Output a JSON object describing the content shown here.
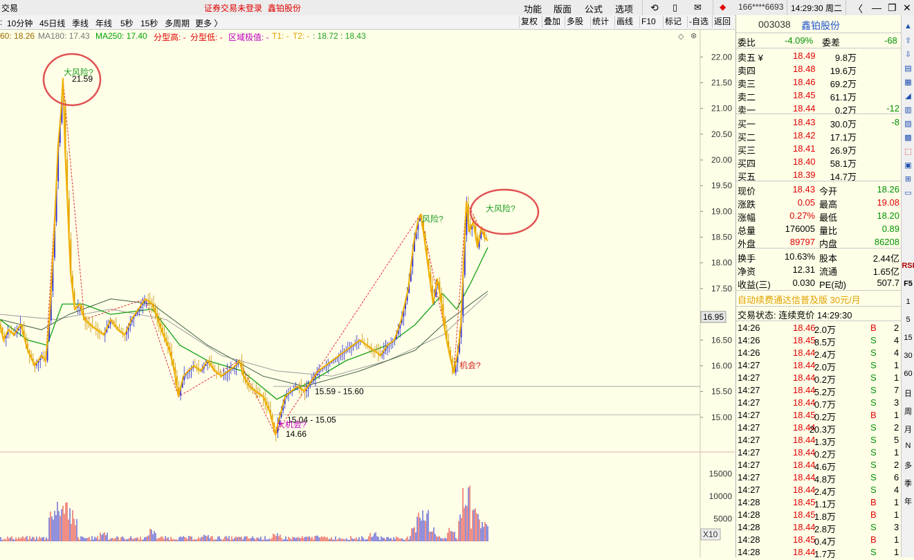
{
  "topbar": {
    "left_label": "交易",
    "login_status": "证券交易未登录",
    "stock_name": "鑫铂股份",
    "menu": [
      "功能",
      "版面",
      "公式",
      "选项"
    ],
    "account": "166****6693",
    "clock": "14:29:30 周二"
  },
  "periods": [
    "10分钟",
    "45日线",
    "季线",
    "年线",
    "5秒",
    "15秒",
    "多周期",
    "更多 〉"
  ],
  "toolbar": [
    "复权",
    "叠加",
    "多股",
    "统计",
    "画线",
    "F10",
    "标记",
    "-自选",
    "返回"
  ],
  "indicators": {
    "ma60": "60: 18.26",
    "ma180": "MA180: 17.43",
    "ma250": "MA250: 17.40",
    "top": "分型高: -",
    "bottom": "分型低: -",
    "zone": "区域极值: -",
    "t1": "T1: -",
    "t2": "T2: -",
    "tvals": ": 18.72 : 18.43"
  },
  "colors": {
    "up": "#e00000",
    "down": "#009000",
    "ma_yellow": "#f0b000",
    "candle_blue": "#2020d0",
    "annot_purple": "#c000c0",
    "circle": "#e05050"
  },
  "chart_data": {
    "type": "candlestick",
    "y_axis": {
      "ylim": [
        14.5,
        22.3
      ],
      "ticks": [
        "22.00",
        "21.50",
        "21.00",
        "20.50",
        "20.00",
        "19.50",
        "19.00",
        "18.50",
        "18.00",
        "17.50",
        "16.50",
        "16.00",
        "15.50",
        "15.00"
      ]
    },
    "current_price_tag": "16.95",
    "volume_axis": {
      "ticks": [
        "15000",
        "10000",
        "5000"
      ],
      "multiplier": "X10",
      "ylim": [
        0,
        18000
      ]
    },
    "price_path": [
      [
        0,
        16.8
      ],
      [
        5,
        16.5
      ],
      [
        12,
        16.7
      ],
      [
        20,
        16.6
      ],
      [
        30,
        16.8
      ],
      [
        40,
        16.3
      ],
      [
        50,
        16.0
      ],
      [
        60,
        16.2
      ],
      [
        66,
        16.1
      ],
      [
        72,
        17.0
      ],
      [
        78,
        18.5
      ],
      [
        84,
        20.3
      ],
      [
        88,
        20.9
      ],
      [
        91,
        21.59
      ],
      [
        94,
        20.2
      ],
      [
        98,
        19.0
      ],
      [
        102,
        17.8
      ],
      [
        108,
        17.1
      ],
      [
        115,
        17.2
      ],
      [
        122,
        16.9
      ],
      [
        130,
        16.8
      ],
      [
        140,
        16.7
      ],
      [
        150,
        16.6
      ],
      [
        160,
        16.9
      ],
      [
        170,
        16.7
      ],
      [
        180,
        16.6
      ],
      [
        190,
        16.9
      ],
      [
        200,
        17.1
      ],
      [
        210,
        17.3
      ],
      [
        220,
        17.2
      ],
      [
        228,
        16.9
      ],
      [
        236,
        16.6
      ],
      [
        245,
        16.3
      ],
      [
        252,
        15.9
      ],
      [
        258,
        15.4
      ],
      [
        265,
        15.8
      ],
      [
        272,
        15.9
      ],
      [
        280,
        16.0
      ],
      [
        290,
        15.9
      ],
      [
        300,
        16.1
      ],
      [
        310,
        15.9
      ],
      [
        320,
        15.8
      ],
      [
        330,
        15.9
      ],
      [
        340,
        16.0
      ],
      [
        346,
        16.1
      ],
      [
        352,
        15.8
      ],
      [
        360,
        15.6
      ],
      [
        370,
        15.5
      ],
      [
        380,
        15.4
      ],
      [
        390,
        15.1
      ],
      [
        398,
        14.66
      ],
      [
        404,
        15.0
      ],
      [
        412,
        15.4
      ],
      [
        420,
        15.5
      ],
      [
        430,
        15.6
      ],
      [
        440,
        15.5
      ],
      [
        450,
        15.7
      ],
      [
        460,
        15.9
      ],
      [
        470,
        16.0
      ],
      [
        480,
        16.1
      ],
      [
        490,
        16.2
      ],
      [
        500,
        16.3
      ],
      [
        510,
        16.4
      ],
      [
        520,
        16.5
      ],
      [
        530,
        16.4
      ],
      [
        540,
        16.3
      ],
      [
        550,
        16.2
      ],
      [
        560,
        16.4
      ],
      [
        570,
        16.5
      ],
      [
        580,
        16.9
      ],
      [
        590,
        17.5
      ],
      [
        598,
        18.4
      ],
      [
        604,
        18.8
      ],
      [
        608,
        18.95
      ],
      [
        614,
        18.4
      ],
      [
        620,
        17.8
      ],
      [
        626,
        17.2
      ],
      [
        632,
        17.7
      ],
      [
        638,
        17.2
      ],
      [
        644,
        16.6
      ],
      [
        650,
        16.2
      ],
      [
        656,
        15.85
      ],
      [
        662,
        16.3
      ],
      [
        666,
        16.8
      ],
      [
        670,
        18.0
      ],
      [
        674,
        19.2
      ],
      [
        678,
        18.6
      ],
      [
        684,
        18.8
      ],
      [
        690,
        18.3
      ],
      [
        696,
        18.7
      ],
      [
        700,
        18.5
      ],
      [
        705,
        18.43
      ]
    ],
    "ma_green_path": [
      [
        0,
        16.9
      ],
      [
        40,
        16.5
      ],
      [
        68,
        16.4
      ],
      [
        90,
        17.2
      ],
      [
        120,
        17.2
      ],
      [
        160,
        17.0
      ],
      [
        220,
        17.1
      ],
      [
        260,
        16.4
      ],
      [
        300,
        16.1
      ],
      [
        350,
        15.9
      ],
      [
        400,
        15.35
      ],
      [
        450,
        15.7
      ],
      [
        500,
        16.1
      ],
      [
        560,
        16.4
      ],
      [
        600,
        16.8
      ],
      [
        640,
        17.4
      ],
      [
        660,
        17.1
      ],
      [
        680,
        17.6
      ],
      [
        705,
        18.3
      ]
    ],
    "ma_dark_path": [
      [
        0,
        16.9
      ],
      [
        60,
        16.7
      ],
      [
        100,
        17.0
      ],
      [
        160,
        17.3
      ],
      [
        220,
        17.2
      ],
      [
        300,
        16.4
      ],
      [
        380,
        15.8
      ],
      [
        440,
        15.6
      ],
      [
        520,
        15.9
      ],
      [
        600,
        16.3
      ],
      [
        640,
        16.8
      ],
      [
        670,
        17.1
      ],
      [
        705,
        17.45
      ]
    ],
    "ma_gray_path": [
      [
        0,
        17.0
      ],
      [
        80,
        16.9
      ],
      [
        160,
        17.1
      ],
      [
        240,
        16.9
      ],
      [
        320,
        16.2
      ],
      [
        400,
        15.9
      ],
      [
        480,
        15.8
      ],
      [
        560,
        16.1
      ],
      [
        640,
        16.6
      ],
      [
        705,
        17.4
      ]
    ],
    "zigzag": [
      [
        66,
        16.1
      ],
      [
        91,
        21.59
      ],
      [
        122,
        16.9
      ],
      [
        210,
        17.3
      ],
      [
        258,
        15.4
      ],
      [
        346,
        16.1
      ],
      [
        398,
        14.66
      ],
      [
        608,
        18.95
      ],
      [
        656,
        15.85
      ],
      [
        674,
        19.2
      ],
      [
        700,
        18.5
      ]
    ],
    "hlines": [
      15.6,
      15.05
    ],
    "annotations": [
      {
        "text": "大风险?",
        "x": 92,
        "y": 21.65,
        "color": "#20a020"
      },
      {
        "text": "21.59",
        "x": 104,
        "y": 21.52,
        "color": "#000000"
      },
      {
        "text": "风险?",
        "x": 610,
        "y": 18.8,
        "color": "#20a020"
      },
      {
        "text": "大风险?",
        "x": 702,
        "y": 19.0,
        "color": "#20a020"
      },
      {
        "text": "机会?",
        "x": 664,
        "y": 15.95,
        "color": "#d02020"
      },
      {
        "text": "15.59 - 15.60",
        "x": 455,
        "y": 15.45,
        "color": "#000000"
      },
      {
        "text": "15.04 - 15.05",
        "x": 415,
        "y": 14.9,
        "color": "#000000"
      },
      {
        "text": "大机会?",
        "x": 400,
        "y": 14.8,
        "color": "#c000c0"
      },
      {
        "text": "14.66",
        "x": 413,
        "y": 14.62,
        "color": "#000000"
      }
    ],
    "volume_spikes": [
      [
        75,
        9000
      ],
      [
        82,
        9500
      ],
      [
        88,
        7500
      ],
      [
        93,
        9000
      ],
      [
        100,
        8000
      ],
      [
        106,
        5500
      ],
      [
        150,
        2500
      ],
      [
        220,
        3000
      ],
      [
        300,
        1500
      ],
      [
        400,
        1800
      ],
      [
        460,
        1500
      ],
      [
        540,
        2200
      ],
      [
        600,
        4500
      ],
      [
        608,
        9800
      ],
      [
        615,
        7000
      ],
      [
        625,
        3500
      ],
      [
        652,
        3000
      ],
      [
        668,
        6000
      ],
      [
        674,
        16500
      ],
      [
        680,
        6500
      ],
      [
        688,
        9000
      ],
      [
        696,
        5500
      ],
      [
        702,
        4000
      ]
    ]
  },
  "quote": {
    "code": "003038",
    "name": "鑫铂股份",
    "webi_label": "委比",
    "webi_value": "-4.09%",
    "weicha_label": "委差",
    "weicha_value": "-68",
    "asks": [
      {
        "label": "卖五 ¥",
        "price": "18.49",
        "vol": "9.8万",
        "chg": ""
      },
      {
        "label": "卖四",
        "price": "18.48",
        "vol": "19.6万",
        "chg": ""
      },
      {
        "label": "卖三",
        "price": "18.46",
        "vol": "69.2万",
        "chg": ""
      },
      {
        "label": "卖二",
        "price": "18.45",
        "vol": "61.1万",
        "chg": ""
      },
      {
        "label": "卖一",
        "price": "18.44",
        "vol": "0.2万",
        "chg": "-12"
      }
    ],
    "bids": [
      {
        "label": "买一",
        "price": "18.43",
        "vol": "30.0万",
        "chg": "-8"
      },
      {
        "label": "买二",
        "price": "18.42",
        "vol": "17.1万",
        "chg": ""
      },
      {
        "label": "买三",
        "price": "18.41",
        "vol": "26.9万",
        "chg": ""
      },
      {
        "label": "买四",
        "price": "18.40",
        "vol": "58.1万",
        "chg": ""
      },
      {
        "label": "买五",
        "price": "18.39",
        "vol": "14.7万",
        "chg": ""
      }
    ],
    "stats": [
      {
        "l1": "现价",
        "v1": "18.43",
        "c1": "red",
        "l2": "今开",
        "v2": "18.26",
        "c2": "green"
      },
      {
        "l1": "涨跌",
        "v1": "0.05",
        "c1": "red",
        "l2": "最高",
        "v2": "19.08",
        "c2": "red"
      },
      {
        "l1": "涨幅",
        "v1": "0.27%",
        "c1": "red",
        "l2": "最低",
        "v2": "18.20",
        "c2": "green"
      },
      {
        "l1": "总量",
        "v1": "176005",
        "c1": "black",
        "l2": "量比",
        "v2": "0.89",
        "c2": "green"
      },
      {
        "l1": "外盘",
        "v1": "89797",
        "c1": "red",
        "l2": "内盘",
        "v2": "86208",
        "c2": "green"
      }
    ],
    "stats2": [
      {
        "l1": "换手",
        "v1": "10.63%",
        "l2": "股本",
        "v2": "2.44亿"
      },
      {
        "l1": "净资",
        "v1": "12.31",
        "l2": "流通",
        "v2": "1.65亿"
      },
      {
        "l1": "收益(三)",
        "v1": "0.030",
        "l2": "PE(动)",
        "v2": "507.7"
      }
    ],
    "ad": "自动续费通达信普及版 30元/月",
    "trade_status": "交易状态: 连续竞价 14:29:30",
    "ticks": [
      {
        "t": "14:26",
        "p": "18.46",
        "v": "2.0万",
        "d": "B",
        "n": "2"
      },
      {
        "t": "14:26",
        "p": "18.45",
        "v": "8.5万",
        "d": "S",
        "n": "4"
      },
      {
        "t": "14:26",
        "p": "18.44",
        "v": "2.4万",
        "d": "S",
        "n": "4"
      },
      {
        "t": "14:27",
        "p": "18.44",
        "v": "2.0万",
        "d": "S",
        "n": "1"
      },
      {
        "t": "14:27",
        "p": "18.44",
        "v": "0.2万",
        "d": "S",
        "n": "1"
      },
      {
        "t": "14:27",
        "p": "18.44",
        "v": "5.2万",
        "d": "S",
        "n": "7"
      },
      {
        "t": "14:27",
        "p": "18.44",
        "v": "0.7万",
        "d": "S",
        "n": "3"
      },
      {
        "t": "14:27",
        "p": "18.45",
        "v": "0.2万",
        "d": "B",
        "n": "1"
      },
      {
        "t": "14:27",
        "p": "18.44",
        "v": "20.3万",
        "d": "S",
        "n": "2"
      },
      {
        "t": "14:27",
        "p": "18.44",
        "v": "1.3万",
        "d": "S",
        "n": "5"
      },
      {
        "t": "14:27",
        "p": "18.44",
        "v": "0.2万",
        "d": "S",
        "n": "1"
      },
      {
        "t": "14:27",
        "p": "18.44",
        "v": "4.6万",
        "d": "S",
        "n": "2"
      },
      {
        "t": "14:27",
        "p": "18.44",
        "v": "4.8万",
        "d": "S",
        "n": "6"
      },
      {
        "t": "14:27",
        "p": "18.44",
        "v": "2.4万",
        "d": "S",
        "n": "4"
      },
      {
        "t": "14:28",
        "p": "18.45",
        "v": "1.1万",
        "d": "B",
        "n": "1"
      },
      {
        "t": "14:28",
        "p": "18.45",
        "v": "1.8万",
        "d": "B",
        "n": "1"
      },
      {
        "t": "14:28",
        "p": "18.44",
        "v": "2.8万",
        "d": "S",
        "n": "3"
      },
      {
        "t": "14:28",
        "p": "18.45",
        "v": "0.4万",
        "d": "B",
        "n": "1"
      },
      {
        "t": "14:28",
        "p": "18.44",
        "v": "1.7万",
        "d": "S",
        "n": "1"
      }
    ]
  },
  "sidebar_right": [
    "RSI",
    "F5",
    "1",
    "5",
    "15",
    "30",
    "60",
    "日",
    "周",
    "月",
    "N",
    "多",
    "季",
    "年"
  ]
}
